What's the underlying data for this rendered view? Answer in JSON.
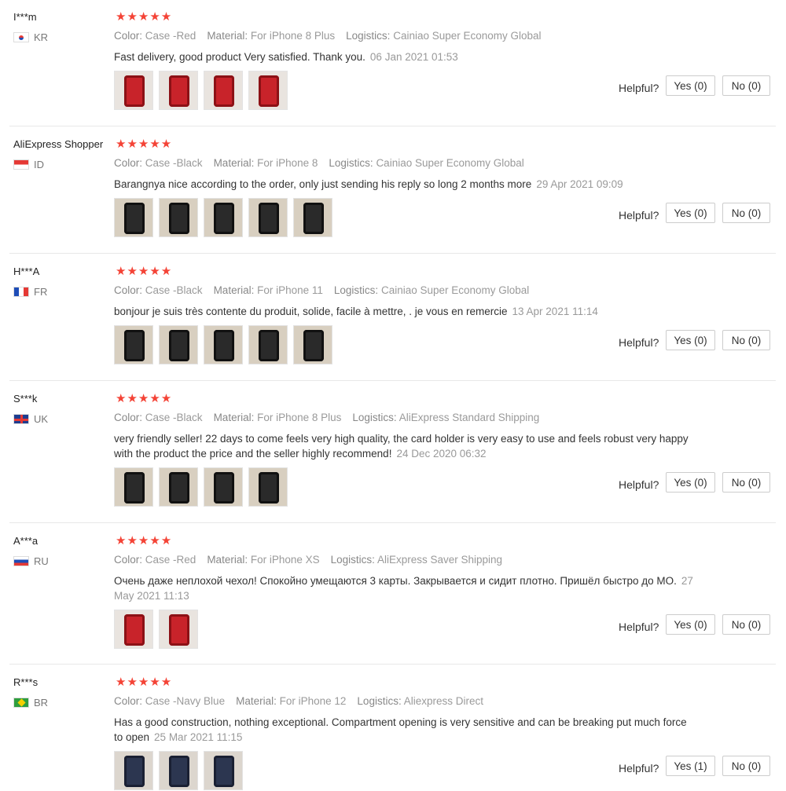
{
  "labels": {
    "color": "Color:",
    "material": "Material:",
    "logistics": "Logistics:",
    "helpful": "Helpful?"
  },
  "stars": "★★★★★",
  "colors": {
    "star": "#f44336",
    "border": "#e8e8e8"
  },
  "reviews": [
    {
      "user": "I***m",
      "country": "KR",
      "flag": "flag-kr-icon",
      "color": "Case -Red",
      "material": "For iPhone 8 Plus",
      "logistics": "Cainiao Super Economy Global",
      "text": "Fast delivery, good product Very satisfied. Thank you.",
      "date": "06 Jan 2021 01:53",
      "yes": "Yes (0)",
      "no": "No (0)",
      "photos": [
        "red-case-photo",
        "red-case-photo",
        "red-case-photo",
        "red-case-photo"
      ]
    },
    {
      "user": "AliExpress Shopper",
      "country": "ID",
      "flag": "flag-id-icon",
      "color": "Case -Black",
      "material": "For iPhone 8",
      "logistics": "Cainiao Super Economy Global",
      "text": "Barangnya nice according to the order, only just sending his reply so long 2 months more",
      "date": "29 Apr 2021 09:09",
      "yes": "Yes (0)",
      "no": "No (0)",
      "photos": [
        "black-case-photo",
        "black-case-photo",
        "black-case-photo",
        "black-case-photo",
        "black-case-photo"
      ]
    },
    {
      "user": "H***A",
      "country": "FR",
      "flag": "flag-fr-icon",
      "color": "Case -Black",
      "material": "For iPhone 11",
      "logistics": "Cainiao Super Economy Global",
      "text": "bonjour je suis très contente du produit, solide, facile à mettre, . je vous en remercie",
      "date": "13 Apr 2021 11:14",
      "yes": "Yes (0)",
      "no": "No (0)",
      "photos": [
        "black-case-photo",
        "black-case-photo",
        "black-case-photo",
        "black-case-photo",
        "black-case-photo"
      ]
    },
    {
      "user": "S***k",
      "country": "UK",
      "flag": "flag-uk-icon",
      "color": "Case -Black",
      "material": "For iPhone 8 Plus",
      "logistics": "AliExpress Standard Shipping",
      "text": "very friendly seller! 22 days to come feels very high quality, the card holder is very easy to use and feels robust very happy with the product the price and the seller highly recommend!",
      "date": "24 Dec 2020 06:32",
      "yes": "Yes (0)",
      "no": "No (0)",
      "photos": [
        "black-case-photo",
        "black-case-photo",
        "black-case-photo",
        "black-case-photo"
      ]
    },
    {
      "user": "A***a",
      "country": "RU",
      "flag": "flag-ru-icon",
      "color": "Case -Red",
      "material": "For iPhone XS",
      "logistics": "AliExpress Saver Shipping",
      "text": "Очень даже неплохой чехол! Спокойно умещаются 3 карты. Закрывается и сидит плотно. Пришёл быстро до МО.",
      "date": "27 May 2021 11:13",
      "yes": "Yes (0)",
      "no": "No (0)",
      "photos": [
        "red-case-photo",
        "red-case-photo"
      ]
    },
    {
      "user": "R***s",
      "country": "BR",
      "flag": "flag-br-icon",
      "color": "Case -Navy Blue",
      "material": "For iPhone 12",
      "logistics": "Aliexpress Direct",
      "text": "Has a good construction, nothing exceptional. Compartment opening is very sensitive and can be breaking put much force to open",
      "date": "25 Mar 2021 11:15",
      "yes": "Yes (1)",
      "no": "No (0)",
      "photos": [
        "navy-case-photo",
        "navy-case-photo",
        "navy-case-photo"
      ]
    }
  ]
}
